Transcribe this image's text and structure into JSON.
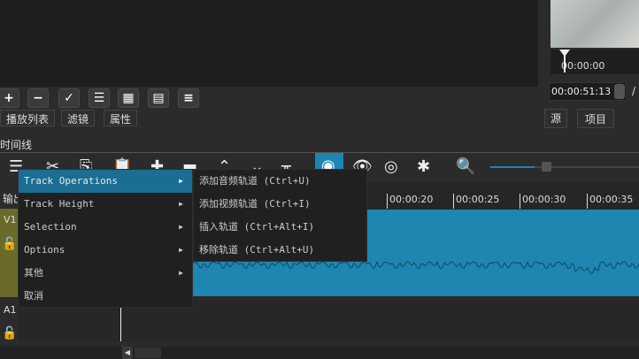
{
  "preview": {
    "ruler_time": "00:00:00",
    "timecode": "00:00:51:13",
    "separator": "/"
  },
  "playlist_buttons": [
    "+",
    "−",
    "✓",
    "☰",
    "▦",
    "▤",
    "≡"
  ],
  "left_tabs": [
    "播放列表",
    "滤镜",
    "属性"
  ],
  "right_tabs": [
    "源",
    "项目"
  ],
  "timeline": {
    "label": "时间线",
    "output_label": "输出",
    "v1": "V1",
    "a1": "A1",
    "ruler_ticks": [
      "00:00:20",
      "00:00:25",
      "00:00:30",
      "00:00:35"
    ],
    "zoom_level": 0.3
  },
  "menu": {
    "items": [
      {
        "label": "Track Operations",
        "submenu": true
      },
      {
        "label": "Track Height",
        "submenu": true
      },
      {
        "label": "Selection",
        "submenu": true
      },
      {
        "label": "Options",
        "submenu": true
      },
      {
        "label": "其他",
        "submenu": true
      },
      {
        "label": "取消",
        "submenu": false
      }
    ],
    "submenu": [
      "添加音频轨道 (Ctrl+U)",
      "添加视频轨道 (Ctrl+I)",
      "插入轨道 (Ctrl+Alt+I)",
      "移除轨道 (Ctrl+Alt+U)"
    ]
  },
  "colors": {
    "accent": "#1e86b0",
    "menu_highlight": "#1b6e92",
    "track_header": "#6b6a2a"
  }
}
